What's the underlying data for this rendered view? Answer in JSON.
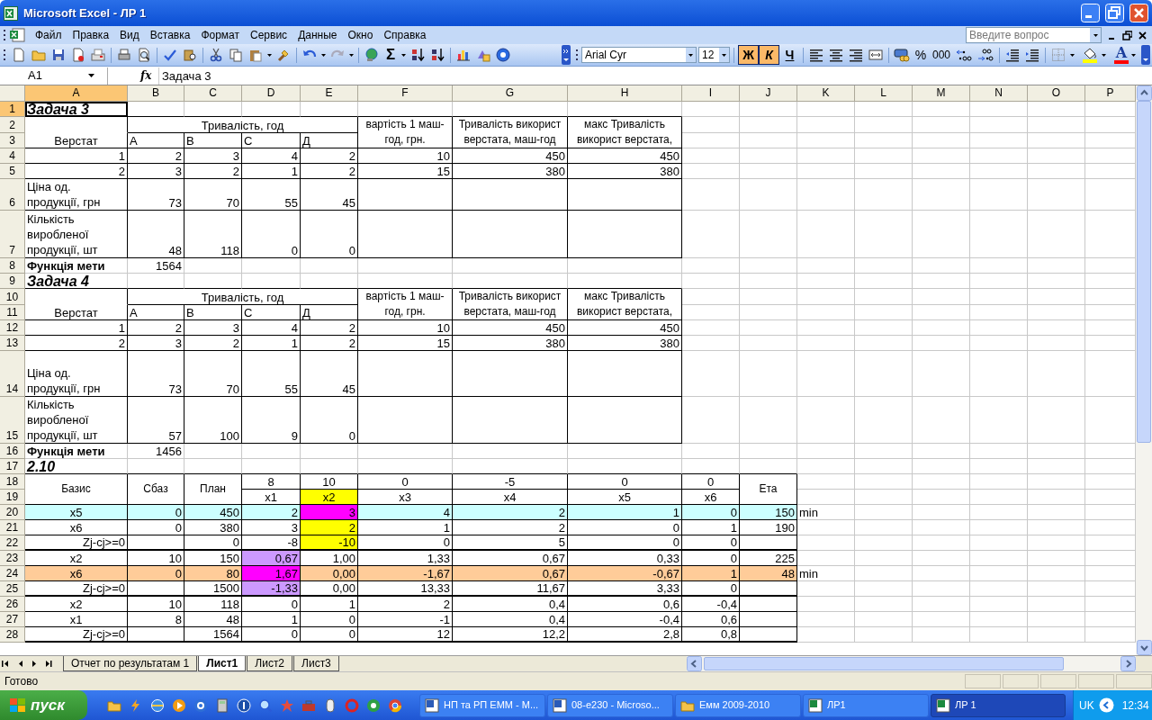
{
  "window": {
    "title": "Microsoft Excel - ЛР 1"
  },
  "menu": {
    "items": [
      "Файл",
      "Правка",
      "Вид",
      "Вставка",
      "Формат",
      "Сервис",
      "Данные",
      "Окно",
      "Справка"
    ]
  },
  "help_search": {
    "placeholder": "Введите вопрос"
  },
  "toolbar": {
    "sum": "Σ",
    "font": "Arial Cyr",
    "size": "12",
    "styles": [
      {
        "label": "Ж",
        "on": true
      },
      {
        "label": "К",
        "on": true
      },
      {
        "label": "Ч",
        "on": false
      }
    ],
    "percent": "%",
    "thousands": "000",
    "font_color": "A"
  },
  "formula_bar": {
    "name_box": "A1",
    "fx": "fx",
    "value": "Задача 3"
  },
  "sheet": {
    "columns": [
      {
        "label": "A",
        "selected": true
      },
      {
        "label": "B",
        "selected": false
      },
      {
        "label": "C",
        "selected": false
      },
      {
        "label": "D",
        "selected": false
      },
      {
        "label": "E",
        "selected": false
      },
      {
        "label": "F",
        "selected": false
      },
      {
        "label": "G",
        "selected": false
      },
      {
        "label": "H",
        "selected": false
      },
      {
        "label": "I",
        "selected": false
      },
      {
        "label": "J",
        "selected": false
      },
      {
        "label": "K",
        "selected": false
      },
      {
        "label": "L",
        "selected": false
      },
      {
        "label": "M",
        "selected": false
      },
      {
        "label": "N",
        "selected": false
      },
      {
        "label": "O",
        "selected": false
      },
      {
        "label": "P",
        "selected": false
      }
    ],
    "rows": [
      {
        "number": "1",
        "selected": true,
        "cells": [
          {
            "text": "Задача 3",
            "kind": "title"
          }
        ]
      },
      {
        "number": "2",
        "selected": false,
        "cells": [
          null,
          {
            "text": "Тривалість, год",
            "kind": "center",
            "colspan": 4
          },
          {
            "text": "вартість 1 маш-год, грн.",
            "kind": "head",
            "rowspan": 2
          },
          {
            "text": "Тривалість використ верстата, маш-год",
            "kind": "head",
            "rowspan": 2
          },
          {
            "text": "макс Тривалість використ верстата,",
            "kind": "head",
            "rowspan": 2
          }
        ]
      },
      {
        "number": "3",
        "selected": false,
        "cells": [
          {
            "text": "Верстат",
            "kind": "center"
          },
          {
            "text": "А",
            "kind": "text"
          },
          {
            "text": "В",
            "kind": "text"
          },
          {
            "text": "С",
            "kind": "text"
          },
          {
            "text": "Д",
            "kind": "text"
          }
        ]
      },
      {
        "number": "4",
        "selected": false,
        "cells": [
          {
            "text": "1",
            "kind": "num"
          },
          {
            "text": "2",
            "kind": "num"
          },
          {
            "text": "3",
            "kind": "num"
          },
          {
            "text": "4",
            "kind": "num"
          },
          {
            "text": "2",
            "kind": "num"
          },
          {
            "text": "10",
            "kind": "num"
          },
          {
            "text": "450",
            "kind": "num"
          },
          {
            "text": "450",
            "kind": "num"
          }
        ]
      },
      {
        "number": "5",
        "selected": false,
        "cells": [
          {
            "text": "2",
            "kind": "num"
          },
          {
            "text": "3",
            "kind": "num"
          },
          {
            "text": "2",
            "kind": "num"
          },
          {
            "text": "1",
            "kind": "num"
          },
          {
            "text": "2",
            "kind": "num"
          },
          {
            "text": "15",
            "kind": "num"
          },
          {
            "text": "380",
            "kind": "num"
          },
          {
            "text": "380",
            "kind": "num"
          }
        ]
      },
      {
        "number": "6",
        "selected": false,
        "cells": [
          {
            "text": "Ціна од. продукції, грн",
            "kind": "wrap"
          },
          {
            "text": "73",
            "kind": "num"
          },
          {
            "text": "70",
            "kind": "num"
          },
          {
            "text": "55",
            "kind": "num"
          },
          {
            "text": "45",
            "kind": "num"
          }
        ]
      },
      {
        "number": "7",
        "selected": false,
        "cells": [
          {
            "text": "Кількість виробленої продукції, шт",
            "kind": "wrap"
          },
          {
            "text": "48",
            "kind": "num"
          },
          {
            "text": "118",
            "kind": "num"
          },
          {
            "text": "0",
            "kind": "num"
          },
          {
            "text": "0",
            "kind": "num"
          }
        ]
      },
      {
        "number": "8",
        "selected": false,
        "cells": [
          {
            "text": "Функція мети",
            "kind": "bold"
          },
          {
            "text": "1564",
            "kind": "num"
          }
        ]
      },
      {
        "number": "9",
        "selected": false,
        "cells": [
          {
            "text": "Задача 4",
            "kind": "title"
          }
        ]
      },
      {
        "number": "10",
        "selected": false,
        "cells": [
          null,
          {
            "text": "Тривалість, год",
            "kind": "center",
            "colspan": 4
          },
          {
            "text": "вартість 1 маш-год, грн.",
            "kind": "head",
            "rowspan": 2
          },
          {
            "text": "Тривалість використ верстата, маш-год",
            "kind": "head",
            "rowspan": 2
          },
          {
            "text": "макс Тривалість використ верстата,",
            "kind": "head",
            "rowspan": 2
          }
        ]
      },
      {
        "number": "11",
        "selected": false,
        "cells": [
          {
            "text": "Верстат",
            "kind": "center"
          },
          {
            "text": "А",
            "kind": "text"
          },
          {
            "text": "В",
            "kind": "text"
          },
          {
            "text": "С",
            "kind": "text"
          },
          {
            "text": "Д",
            "kind": "text"
          }
        ]
      },
      {
        "number": "12",
        "selected": false,
        "cells": [
          {
            "text": "1",
            "kind": "num"
          },
          {
            "text": "2",
            "kind": "num"
          },
          {
            "text": "3",
            "kind": "num"
          },
          {
            "text": "4",
            "kind": "num"
          },
          {
            "text": "2",
            "kind": "num"
          },
          {
            "text": "10",
            "kind": "num"
          },
          {
            "text": "450",
            "kind": "num"
          },
          {
            "text": "450",
            "kind": "num"
          }
        ]
      },
      {
        "number": "13",
        "selected": false,
        "cells": [
          {
            "text": "2",
            "kind": "num"
          },
          {
            "text": "3",
            "kind": "num"
          },
          {
            "text": "2",
            "kind": "num"
          },
          {
            "text": "1",
            "kind": "num"
          },
          {
            "text": "2",
            "kind": "num"
          },
          {
            "text": "15",
            "kind": "num"
          },
          {
            "text": "380",
            "kind": "num"
          },
          {
            "text": "380",
            "kind": "num"
          }
        ]
      },
      {
        "number": "14",
        "selected": false,
        "cells": [
          {
            "text": "Ціна од. продукції, грн",
            "kind": "wrap"
          },
          {
            "text": "73",
            "kind": "num"
          },
          {
            "text": "70",
            "kind": "num"
          },
          {
            "text": "55",
            "kind": "num"
          },
          {
            "text": "45",
            "kind": "num"
          }
        ]
      },
      {
        "number": "15",
        "selected": false,
        "cells": [
          {
            "text": "Кількість виробленої продукції, шт",
            "kind": "wrap"
          },
          {
            "text": "57",
            "kind": "num"
          },
          {
            "text": "100",
            "kind": "num"
          },
          {
            "text": "9",
            "kind": "num"
          },
          {
            "text": "0",
            "kind": "num"
          }
        ]
      },
      {
        "number": "16",
        "selected": false,
        "cells": [
          {
            "text": "Функція мети",
            "kind": "bold"
          },
          {
            "text": "1456",
            "kind": "num"
          }
        ]
      },
      {
        "number": "17",
        "selected": false,
        "cells": [
          {
            "text": "2.10",
            "kind": "title"
          }
        ]
      },
      {
        "number": "18",
        "selected": false,
        "cells": [
          {
            "text": "Базис",
            "kind": "head",
            "rowspan": 2
          },
          {
            "text": "Сбаз",
            "kind": "head",
            "rowspan": 2
          },
          {
            "text": "План",
            "kind": "head",
            "rowspan": 2
          },
          {
            "text": "8",
            "kind": "center"
          },
          {
            "text": "10",
            "kind": "center"
          },
          {
            "text": "0",
            "kind": "center"
          },
          {
            "text": "-5",
            "kind": "center"
          },
          {
            "text": "0",
            "kind": "center"
          },
          {
            "text": "0",
            "kind": "center"
          },
          {
            "text": "Ета",
            "kind": "head",
            "rowspan": 2
          }
        ]
      },
      {
        "number": "19",
        "selected": false,
        "cells": [
          {
            "text": "x1",
            "kind": "center"
          },
          {
            "text": "x2",
            "kind": "center",
            "color": "#ffff00"
          },
          {
            "text": "x3",
            "kind": "center"
          },
          {
            "text": "x4",
            "kind": "center"
          },
          {
            "text": "x5",
            "kind": "center"
          },
          {
            "text": "x6",
            "kind": "center"
          }
        ]
      },
      {
        "number": "20",
        "selected": false,
        "cells": [
          {
            "text": "x5",
            "kind": "center",
            "color": "#ccffff"
          },
          {
            "text": "0",
            "kind": "num",
            "color": "#ccffff"
          },
          {
            "text": "450",
            "kind": "num",
            "color": "#ccffff"
          },
          {
            "text": "2",
            "kind": "num",
            "color": "#ccffff"
          },
          {
            "text": "3",
            "kind": "num",
            "color": "#ff00ff"
          },
          {
            "text": "4",
            "kind": "num",
            "color": "#ccffff"
          },
          {
            "text": "2",
            "kind": "num",
            "color": "#ccffff"
          },
          {
            "text": "1",
            "kind": "num",
            "color": "#ccffff"
          },
          {
            "text": "0",
            "kind": "num",
            "color": "#ccffff"
          },
          {
            "text": "150",
            "kind": "num",
            "color": "#ccffff"
          },
          {
            "text": "min",
            "kind": "text"
          }
        ]
      },
      {
        "number": "21",
        "selected": false,
        "cells": [
          {
            "text": "x6",
            "kind": "center"
          },
          {
            "text": "0",
            "kind": "num"
          },
          {
            "text": "380",
            "kind": "num"
          },
          {
            "text": "3",
            "kind": "num"
          },
          {
            "text": "2",
            "kind": "num",
            "color": "#ffff00"
          },
          {
            "text": "1",
            "kind": "num"
          },
          {
            "text": "2",
            "kind": "num"
          },
          {
            "text": "0",
            "kind": "num"
          },
          {
            "text": "1",
            "kind": "num"
          },
          {
            "text": "190",
            "kind": "num"
          }
        ]
      },
      {
        "number": "22",
        "selected": false,
        "cells": [
          {
            "text": "Zj-cj>=0",
            "kind": "num"
          },
          null,
          {
            "text": "0",
            "kind": "num"
          },
          {
            "text": "-8",
            "kind": "num"
          },
          {
            "text": "-10",
            "kind": "num",
            "color": "#ffff00"
          },
          {
            "text": "0",
            "kind": "num"
          },
          {
            "text": "5",
            "kind": "num"
          },
          {
            "text": "0",
            "kind": "num"
          },
          {
            "text": "0",
            "kind": "num"
          }
        ]
      },
      {
        "number": "23",
        "selected": false,
        "cells": [
          {
            "text": "x2",
            "kind": "center"
          },
          {
            "text": "10",
            "kind": "num"
          },
          {
            "text": "150",
            "kind": "num"
          },
          {
            "text": "0,67",
            "kind": "num",
            "color": "#cc99ff"
          },
          {
            "text": "1,00",
            "kind": "num"
          },
          {
            "text": "1,33",
            "kind": "num"
          },
          {
            "text": "0,67",
            "kind": "num"
          },
          {
            "text": "0,33",
            "kind": "num"
          },
          {
            "text": "0",
            "kind": "num"
          },
          {
            "text": "225",
            "kind": "num"
          }
        ]
      },
      {
        "number": "24",
        "selected": false,
        "cells": [
          {
            "text": "x6",
            "kind": "center",
            "color": "#ffcc99"
          },
          {
            "text": "0",
            "kind": "num",
            "color": "#ffcc99"
          },
          {
            "text": "80",
            "kind": "num",
            "color": "#ffcc99"
          },
          {
            "text": "1,67",
            "kind": "num",
            "color": "#ff00ff"
          },
          {
            "text": "0,00",
            "kind": "num",
            "color": "#ffcc99"
          },
          {
            "text": "-1,67",
            "kind": "num",
            "color": "#ffcc99"
          },
          {
            "text": "0,67",
            "kind": "num",
            "color": "#ffcc99"
          },
          {
            "text": "-0,67",
            "kind": "num",
            "color": "#ffcc99"
          },
          {
            "text": "1",
            "kind": "num",
            "color": "#ffcc99"
          },
          {
            "text": "48",
            "kind": "num",
            "color": "#ffcc99"
          },
          {
            "text": "min",
            "kind": "text"
          }
        ]
      },
      {
        "number": "25",
        "selected": false,
        "cells": [
          {
            "text": "Zj-cj>=0",
            "kind": "num"
          },
          null,
          {
            "text": "1500",
            "kind": "num"
          },
          {
            "text": "-1,33",
            "kind": "num",
            "color": "#cc99ff"
          },
          {
            "text": "0,00",
            "kind": "num"
          },
          {
            "text": "13,33",
            "kind": "num"
          },
          {
            "text": "11,67",
            "kind": "num"
          },
          {
            "text": "3,33",
            "kind": "num"
          },
          {
            "text": "0",
            "kind": "num"
          }
        ]
      },
      {
        "number": "26",
        "selected": false,
        "cells": [
          {
            "text": "x2",
            "kind": "center"
          },
          {
            "text": "10",
            "kind": "num"
          },
          {
            "text": "118",
            "kind": "num"
          },
          {
            "text": "0",
            "kind": "num"
          },
          {
            "text": "1",
            "kind": "num"
          },
          {
            "text": "2",
            "kind": "num"
          },
          {
            "text": "0,4",
            "kind": "num"
          },
          {
            "text": "0,6",
            "kind": "num"
          },
          {
            "text": "-0,4",
            "kind": "num"
          }
        ]
      },
      {
        "number": "27",
        "selected": false,
        "cells": [
          {
            "text": "x1",
            "kind": "center"
          },
          {
            "text": "8",
            "kind": "num"
          },
          {
            "text": "48",
            "kind": "num"
          },
          {
            "text": "1",
            "kind": "num"
          },
          {
            "text": "0",
            "kind": "num"
          },
          {
            "text": "-1",
            "kind": "num"
          },
          {
            "text": "0,4",
            "kind": "num"
          },
          {
            "text": "-0,4",
            "kind": "num"
          },
          {
            "text": "0,6",
            "kind": "num"
          }
        ]
      },
      {
        "number": "28",
        "selected": false,
        "cells": [
          {
            "text": "Zj-cj>=0",
            "kind": "num"
          },
          null,
          {
            "text": "1564",
            "kind": "num"
          },
          {
            "text": "0",
            "kind": "num"
          },
          {
            "text": "0",
            "kind": "num"
          },
          {
            "text": "12",
            "kind": "num"
          },
          {
            "text": "12,2",
            "kind": "num"
          },
          {
            "text": "2,8",
            "kind": "num"
          },
          {
            "text": "0,8",
            "kind": "num"
          }
        ]
      }
    ]
  },
  "sheet_tabs": [
    {
      "label": "Отчет по результатам 1",
      "selected": false
    },
    {
      "label": "Лист1",
      "selected": true
    },
    {
      "label": "Лист2",
      "selected": false
    },
    {
      "label": "Лист3",
      "selected": false
    }
  ],
  "status_bar": {
    "text": "Готово"
  },
  "taskbar": {
    "start": "пуск",
    "tasks": [
      {
        "label": "НП та РП ЕММ - M...",
        "kind": "document",
        "selected": false
      },
      {
        "label": "08-е230 - Microso...",
        "kind": "document",
        "selected": false
      },
      {
        "label": "Емм 2009-2010",
        "kind": "folder",
        "selected": false
      },
      {
        "label": "ЛР1",
        "kind": "spreadsheet",
        "selected": false
      },
      {
        "label": "ЛР 1",
        "kind": "spreadsheet",
        "selected": true
      }
    ],
    "language": "UK",
    "clock": "12:34"
  }
}
